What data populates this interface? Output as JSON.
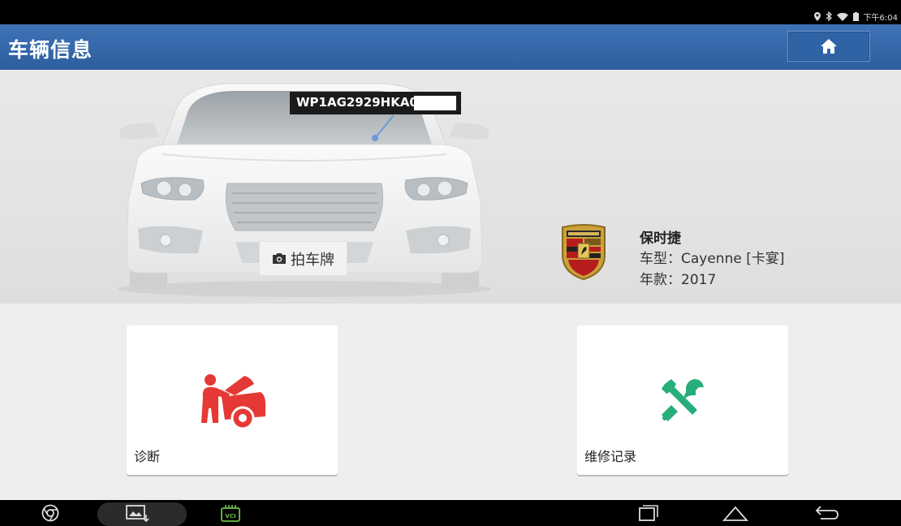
{
  "status_bar": {
    "time": "下午6:04",
    "icons": [
      "location-icon",
      "bluetooth-icon",
      "wifi-icon",
      "battery-icon"
    ]
  },
  "header": {
    "title": "车辆信息",
    "home_icon": "home-icon"
  },
  "vehicle": {
    "vin": "WP1AG2929HKA0",
    "plate_button_label": "拍车牌",
    "plate_button_icon": "camera-icon",
    "brand": "保时捷",
    "model_line": "车型：Cayenne [卡宴]",
    "year_line": "年款：2017",
    "logo": "porsche-crest"
  },
  "cards": [
    {
      "label": "诊断",
      "icon": "mechanic-car-icon",
      "color": "#e53935"
    },
    {
      "label": "维修记录",
      "icon": "tools-icon",
      "color": "#27ae7a"
    }
  ],
  "nav_bar": {
    "items": [
      "chrome-icon",
      "screenshot-icon",
      "vci-icon",
      "recent-apps-icon",
      "home-nav-icon",
      "back-icon"
    ],
    "vci_label": "VCI"
  }
}
